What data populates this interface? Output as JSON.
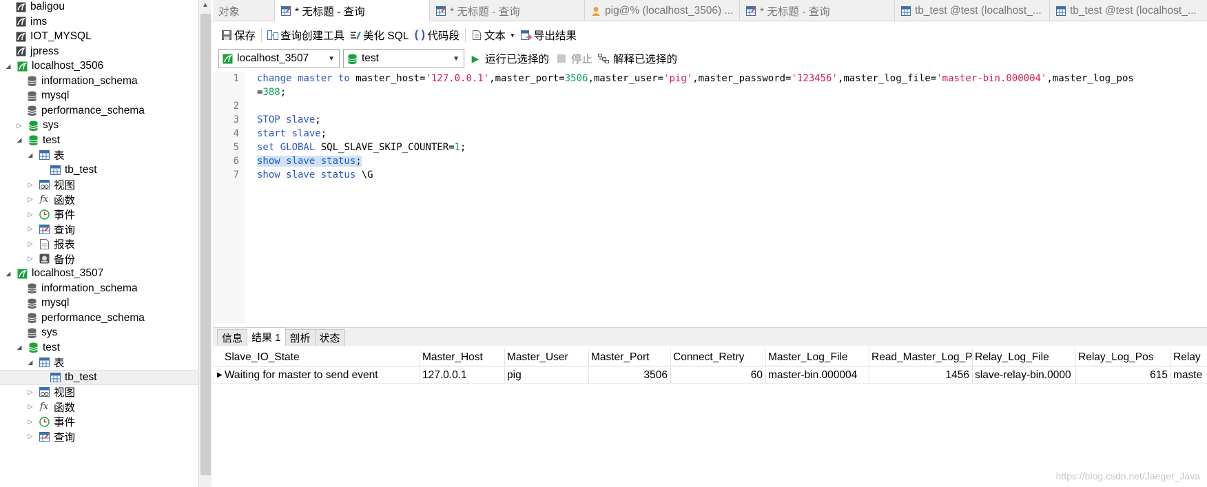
{
  "sidebar": {
    "items": [
      {
        "label": "baligou"
      },
      {
        "label": "ims"
      },
      {
        "label": "IOT_MYSQL"
      },
      {
        "label": "jpress"
      },
      {
        "label": "localhost_3506"
      },
      {
        "label": "information_schema"
      },
      {
        "label": "mysql"
      },
      {
        "label": "performance_schema"
      },
      {
        "label": "sys"
      },
      {
        "label": "test"
      },
      {
        "label": "表"
      },
      {
        "label": "tb_test"
      },
      {
        "label": "视图"
      },
      {
        "label": "函数"
      },
      {
        "label": "事件"
      },
      {
        "label": "查询"
      },
      {
        "label": "报表"
      },
      {
        "label": "备份"
      },
      {
        "label": "localhost_3507"
      },
      {
        "label": "information_schema"
      },
      {
        "label": "mysql"
      },
      {
        "label": "performance_schema"
      },
      {
        "label": "sys"
      },
      {
        "label": "test"
      },
      {
        "label": "表"
      },
      {
        "label": "tb_test"
      },
      {
        "label": "视图"
      },
      {
        "label": "函数"
      },
      {
        "label": "事件"
      },
      {
        "label": "查询"
      }
    ]
  },
  "tabs": [
    {
      "label": "对象"
    },
    {
      "label": "* 无标题 - 查询"
    },
    {
      "label": "* 无标题 - 查询"
    },
    {
      "label": "pig@% (localhost_3506) ..."
    },
    {
      "label": "* 无标题 - 查询"
    },
    {
      "label": "tb_test @test (localhost_..."
    },
    {
      "label": "tb_test @test (localhost_..."
    }
  ],
  "toolbar": {
    "save": "保存",
    "query_builder": "查询创建工具",
    "beautify": "美化 SQL",
    "snippet": "代码段",
    "text": "文本",
    "export": "导出结果"
  },
  "selectors": {
    "connection": "localhost_3507",
    "database": "test",
    "run_selected": "运行已选择的",
    "stop": "停止",
    "explain_selected": "解释已选择的"
  },
  "editor": {
    "line_numbers": [
      "1",
      "",
      "2",
      "3",
      "4",
      "5",
      "6",
      "7"
    ],
    "line1_kw": "change master to",
    "line1_a": " master_host=",
    "line1_s1": "'127.0.0.1'",
    "line1_b": ",master_port=",
    "line1_n1": "3506",
    "line1_c": ",master_user=",
    "line1_s2": "'pig'",
    "line1_d": ",master_password=",
    "line1_s3": "'123456'",
    "line1_e": ",master_log_file=",
    "line1_s4": "'master-bin.000004'",
    "line1_f": ",master_log_pos",
    "line1b_a": "=",
    "line1b_n": "388",
    "line1b_b": ";",
    "line3_kw": "STOP slave",
    "line3_t": ";",
    "line4_kw": "start slave",
    "line4_t": ";",
    "line5_kw": "set GLOBAL",
    "line5_a": " SQL_SLAVE_SKIP_COUNTER=",
    "line5_n": "1",
    "line5_t": ";",
    "line6_kw": "show slave status",
    "line6_t": ";",
    "line7_kw": "show slave status",
    "line7_t": " \\G"
  },
  "result_tabs": [
    {
      "label": "信息"
    },
    {
      "label": "结果 1"
    },
    {
      "label": "剖析"
    },
    {
      "label": "状态"
    }
  ],
  "grid": {
    "columns": [
      "Slave_IO_State",
      "Master_Host",
      "Master_User",
      "Master_Port",
      "Connect_Retry",
      "Master_Log_File",
      "Read_Master_Log_P",
      "Relay_Log_File",
      "Relay_Log_Pos",
      "Relay"
    ],
    "row": [
      "Waiting for master to send event",
      "127.0.0.1",
      "pig",
      "3506",
      "60",
      "master-bin.000004",
      "1456",
      "slave-relay-bin.0000",
      "615",
      "maste"
    ]
  },
  "watermark": "https://blog.csdn.net/Jaeger_Java",
  "colors": {
    "keyword": "#2b55c9",
    "string": "#d8184c",
    "number": "#0ba35e",
    "selection": "#cfe3f7",
    "db_green": "#1aa33a"
  }
}
